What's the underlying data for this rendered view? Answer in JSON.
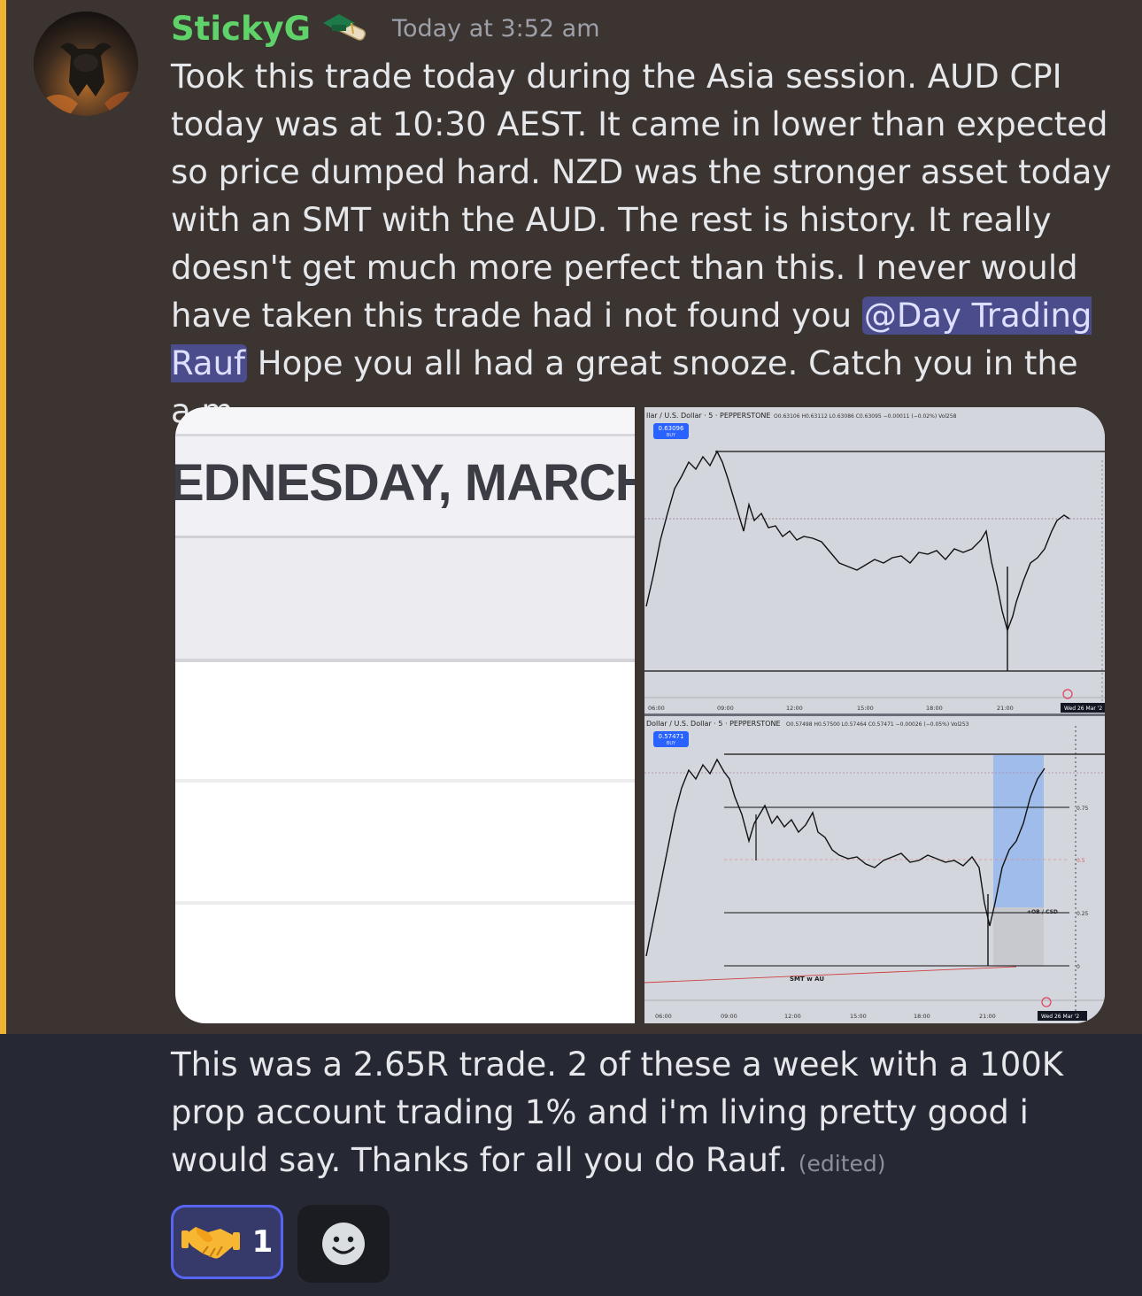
{
  "message": {
    "username": "StickyG",
    "badge_icon": "graduation-cap-scroll-icon",
    "timestamp": "Today at 3:52 am",
    "text_before_mention": "Took this trade today during the Asia session. AUD CPI today was at 10:30 AEST. It came in lower than expected so price dumped hard. NZD was the stronger asset today with an SMT with the AUD. The rest is history. It really doesn't get much more perfect than this. I never would have taken this trade had i not found you ",
    "mention": "@Day Trading Rauf",
    "text_after_mention": " Hope you all had a great snooze. Catch you in the a.m.",
    "followup_text": "This was a 2.65R trade. 2 of these a week with a 100K prop account trading 1% and i'm living pretty good i would say. Thanks for all you do Rauf.",
    "edited_label": "(edited)"
  },
  "attachments": {
    "calendar_image": {
      "day_heading": "EDNESDAY, MARCH"
    },
    "chart_top": {
      "symbol_line": "llar / U.S. Dollar · 5 · PEPPERSTONE",
      "ohlc": "O0.63106 H0.63112 L0.63086 C0.63095 −0.00011 (−0.02%) Vol258",
      "price_tag": "0.63096",
      "tag_sub": "BUY",
      "x_ticks": [
        "06:00",
        "09:00",
        "12:00",
        "15:00",
        "18:00",
        "21:00"
      ],
      "date_tag": "Wed 26 Mar '2"
    },
    "chart_bottom": {
      "symbol_line": "Dollar / U.S. Dollar · 5 · PEPPERSTONE",
      "ohlc": "O0.57498 H0.57500 L0.57464 C0.57471 −0.00026 (−0.05%) Vol253",
      "price_tag": "0.57471",
      "tag_sub": "BUY",
      "fib_levels": [
        "0.75",
        "0.5",
        "0.25",
        "0"
      ],
      "ob_label": "+OB / CSD",
      "smt_label": "SMT w AU",
      "x_ticks": [
        "06:00",
        "09:00",
        "12:00",
        "15:00",
        "18:00",
        "21:00"
      ],
      "date_tag": "Wed 26 Mar '2"
    }
  },
  "reactions": [
    {
      "emoji": "🤝",
      "icon": "handshake-icon",
      "count": "1"
    }
  ],
  "add_reaction_icon": "smiley-add-reaction-icon",
  "colors": {
    "username": "#5fd36a",
    "mention_bar": "#f0b232",
    "mention_bg": "#4b4c8c",
    "reaction_border": "#5865f2"
  }
}
